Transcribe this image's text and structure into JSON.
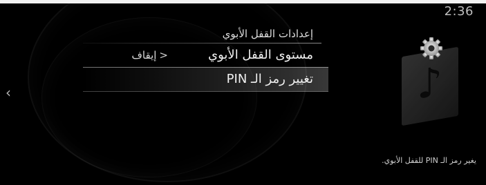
{
  "clock": "2:36",
  "menu": {
    "title": "إعدادات القفل الأبوي",
    "items": [
      {
        "label": "مستوى القفل الأبوي",
        "value": "إيقاف"
      },
      {
        "label": "تغيير رمز الـ PIN"
      }
    ]
  },
  "help_text": "يغير رمز الـ PIN للقفل الأبوي.",
  "icons": {
    "back": "chevron-left-icon",
    "settings": "gear-icon",
    "music": "music-note-icon",
    "value_chevron": "chevron-left-icon"
  }
}
